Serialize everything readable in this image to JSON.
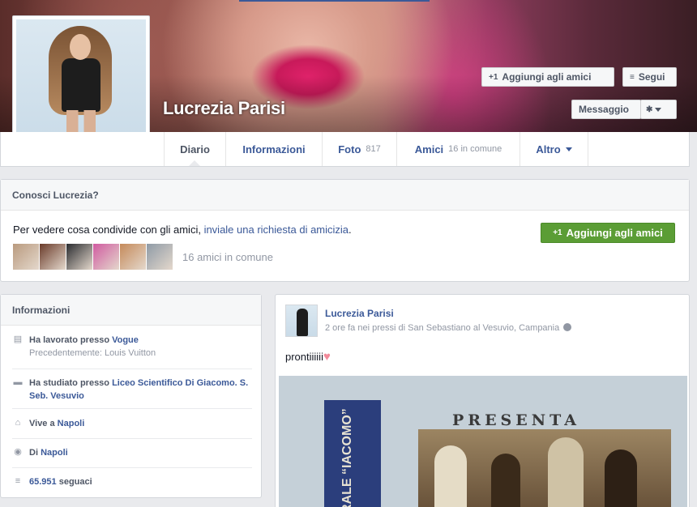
{
  "profile": {
    "name": "Lucrezia Parisi"
  },
  "actions": {
    "add_friend": "Aggiungi agli amici",
    "follow": "Segui",
    "message": "Messaggio"
  },
  "tabs": [
    {
      "label": "Diario",
      "count": ""
    },
    {
      "label": "Informazioni",
      "count": ""
    },
    {
      "label": "Foto",
      "count": "817"
    },
    {
      "label": "Amici",
      "count": "16 in comune"
    },
    {
      "label": "Altro",
      "count": ""
    }
  ],
  "know": {
    "title": "Conosci Lucrezia?",
    "text_before": "Per vedere cosa condivide con gli amici, ",
    "link": "inviale una richiesta di amicizia",
    "text_after": ".",
    "button": "Aggiungi agli amici",
    "mutual": "16 amici in comune",
    "thumb_colors": [
      "#b99a7e",
      "#6a3b2a",
      "#2a2c30",
      "#d05aa0",
      "#c58a5a",
      "#8e9aa6"
    ]
  },
  "info": {
    "title": "Informazioni",
    "rows": [
      {
        "icon": "briefcase-icon",
        "prefix": "Ha lavorato presso ",
        "link": "Vogue",
        "sub": "Precedentemente: Louis Vuitton"
      },
      {
        "icon": "school-icon",
        "prefix": "Ha studiato presso ",
        "link": "Liceo Scientifico Di Giacomo. S. Seb. Vesuvio",
        "sub": ""
      },
      {
        "icon": "home-icon",
        "prefix": "Vive a ",
        "link": "Napoli",
        "sub": ""
      },
      {
        "icon": "location-pin-icon",
        "prefix": "Di ",
        "link": "Napoli",
        "sub": ""
      },
      {
        "icon": "rss-icon",
        "prefix": "",
        "link": "65.951",
        "suffix": " seguaci",
        "sub": ""
      }
    ]
  },
  "post": {
    "author": "Lucrezia Parisi",
    "meta": "2 ore fa nei pressi di San Sebastiano al Vesuvio, Campania",
    "text": "prontiiiiii",
    "photo": {
      "poster_text": "RALE “IACOMO”",
      "heading": "PRESENTA"
    }
  },
  "colors": {
    "link": "#3b5998",
    "green_button": "#5b9d35",
    "background": "#e9eaed"
  }
}
